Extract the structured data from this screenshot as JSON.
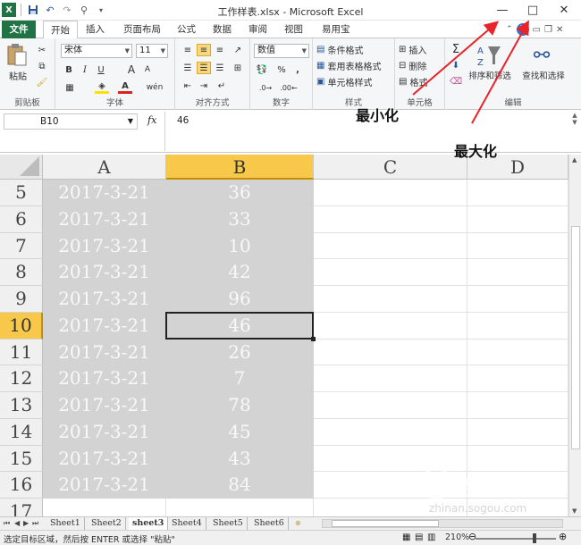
{
  "window": {
    "title": "工作样表.xlsx - Microsoft Excel",
    "minimize_glyph": "—",
    "maximize_glyph": "□",
    "close_glyph": "✕"
  },
  "ribbon_tabs": [
    {
      "label": "文件"
    },
    {
      "label": "开始"
    },
    {
      "label": "插入"
    },
    {
      "label": "页面布局"
    },
    {
      "label": "公式"
    },
    {
      "label": "数据"
    },
    {
      "label": "审阅"
    },
    {
      "label": "视图"
    },
    {
      "label": "易用宝"
    }
  ],
  "ribbon": {
    "clipboard": {
      "paste_label": "粘贴",
      "group_label": "剪贴板"
    },
    "font": {
      "font_name": "宋体",
      "font_size": "11",
      "group_label": "字体",
      "bold": "B",
      "italic": "I",
      "underline": "U",
      "grow": "A",
      "shrink": "A",
      "change_case": "wén"
    },
    "alignment": {
      "group_label": "对齐方式"
    },
    "number": {
      "format_value": "数值",
      "group_label": "数字",
      "percent": "%",
      "comma": ","
    },
    "styles": {
      "conditional": "条件格式",
      "table_format": "套用表格格式",
      "cell_styles": "单元格样式",
      "group_label": "样式"
    },
    "cells": {
      "insert": "插入",
      "delete": "删除",
      "format": "格式",
      "group_label": "单元格"
    },
    "editing": {
      "sort_filter": "排序和筛选",
      "find_select": "查找和选择",
      "group_label": "编辑",
      "sigma": "Σ"
    }
  },
  "formula_bar": {
    "name_box": "B10",
    "fx": "fx",
    "value": "46"
  },
  "grid": {
    "columns": [
      {
        "label": "A",
        "selected": false
      },
      {
        "label": "B",
        "selected": true
      },
      {
        "label": "C",
        "selected": false
      },
      {
        "label": "D",
        "selected": false
      }
    ],
    "rows": [
      {
        "num": "5",
        "a": "2017-3-21",
        "b": "36"
      },
      {
        "num": "6",
        "a": "2017-3-21",
        "b": "33"
      },
      {
        "num": "7",
        "a": "2017-3-21",
        "b": "10"
      },
      {
        "num": "8",
        "a": "2017-3-21",
        "b": "42"
      },
      {
        "num": "9",
        "a": "2017-3-21",
        "b": "96"
      },
      {
        "num": "10",
        "a": "2017-3-21",
        "b": "46"
      },
      {
        "num": "11",
        "a": "2017-3-21",
        "b": "26"
      },
      {
        "num": "12",
        "a": "2017-3-21",
        "b": "7"
      },
      {
        "num": "13",
        "a": "2017-3-21",
        "b": "78"
      },
      {
        "num": "14",
        "a": "2017-3-21",
        "b": "45"
      },
      {
        "num": "15",
        "a": "2017-3-21",
        "b": "43"
      },
      {
        "num": "16",
        "a": "2017-3-21",
        "b": "84"
      },
      {
        "num": "17",
        "a": "",
        "b": ""
      }
    ],
    "active_row": "10",
    "active_col": "B"
  },
  "sheet_tabs": [
    "Sheet1",
    "Sheet2",
    "sheet3",
    "Sheet4",
    "Sheet5",
    "Sheet6"
  ],
  "active_sheet": "sheet3",
  "status": {
    "text": "选定目标区域，然后按 ENTER 或选择 \"粘贴\"",
    "zoom": "210%"
  },
  "annotations": {
    "minimize": "最小化",
    "maximize": "最大化",
    "arrow_color": "#e8232a"
  },
  "watermark": {
    "text": "搜狗指南",
    "url": "zhinan.sogou.com"
  },
  "colors": {
    "selected_header": "#f7c84a",
    "data_fill": "#d3d3d3",
    "file_tab": "#217346"
  }
}
